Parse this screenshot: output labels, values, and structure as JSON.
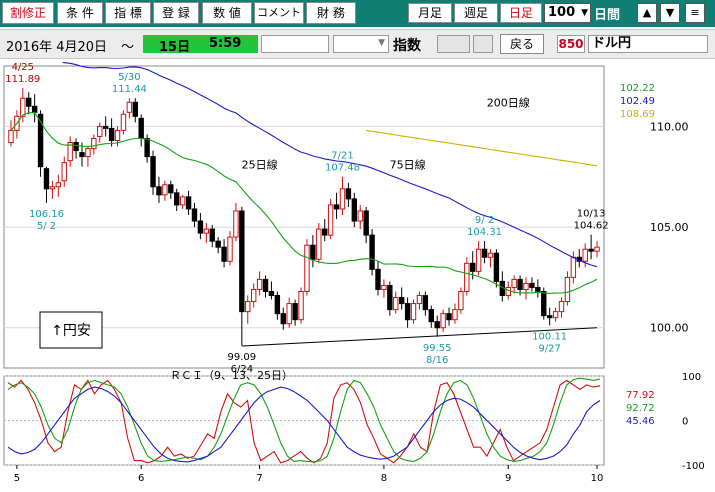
{
  "toolbar": {
    "buttons": [
      "割修正",
      "条 件",
      "指 標",
      "登 録",
      "数 値",
      "コメント",
      "財 務"
    ],
    "periods": [
      "月足",
      "週足",
      "日足"
    ],
    "count_value": "100",
    "days_label": "日間",
    "nav_up": "▲",
    "nav_down": "▼",
    "menu": "≡",
    "colors": {
      "bg": "#0f7f74",
      "active": "#d0021b"
    }
  },
  "infobar": {
    "date": "2016年 4月20日",
    "tilde": "〜",
    "day": "15日",
    "time": "5:59",
    "index_label": "指数",
    "back_label": "戻る",
    "code": "850",
    "name": "ドル円"
  },
  "chart_data": [
    {
      "type": "candlestick",
      "ylim": [
        98,
        113
      ],
      "y_ticks": [
        "110.00",
        "105.00",
        "100.00"
      ],
      "x_ticks": [
        "5",
        "6",
        "7",
        "8",
        "9",
        "10"
      ],
      "legend": [
        {
          "value": "102.22",
          "color": "#16a016"
        },
        {
          "value": "102.49",
          "color": "#1a1ad0"
        },
        {
          "value": "108.69",
          "color": "#c8b400"
        }
      ],
      "ma_labels": {
        "ma25": "25日線",
        "ma75": "75日線",
        "ma200": "200日線"
      },
      "annotations": [
        {
          "date": "4/25",
          "value": "111.89"
        },
        {
          "date": "5/ 2",
          "value": "106.16"
        },
        {
          "date": "5/30",
          "value": "111.44"
        },
        {
          "date": "6/24",
          "value": "99.09"
        },
        {
          "date": "7/21",
          "value": "107.48"
        },
        {
          "date": "8/16",
          "value": "99.55"
        },
        {
          "date": "9/ 2",
          "value": "104.31"
        },
        {
          "date": "9/27",
          "value": "100.11"
        },
        {
          "date": "10/13",
          "value": "104.62"
        }
      ],
      "note": "↑円安",
      "candles": [
        [
          109.2,
          110.3,
          109.0,
          109.8
        ],
        [
          109.8,
          110.8,
          109.4,
          110.5
        ],
        [
          110.5,
          111.9,
          110.2,
          111.4
        ],
        [
          111.4,
          111.7,
          110.6,
          111.0
        ],
        [
          111.0,
          111.6,
          110.2,
          110.7
        ],
        [
          110.6,
          110.8,
          107.5,
          108.0
        ],
        [
          107.9,
          108.0,
          106.2,
          106.9
        ],
        [
          106.9,
          107.3,
          106.4,
          107.0
        ],
        [
          107.0,
          107.6,
          106.5,
          107.2
        ],
        [
          107.3,
          108.5,
          107.0,
          108.2
        ],
        [
          108.3,
          109.5,
          108.0,
          109.2
        ],
        [
          109.2,
          109.4,
          108.4,
          108.8
        ],
        [
          108.7,
          109.2,
          108.0,
          108.5
        ],
        [
          108.5,
          109.0,
          108.0,
          108.9
        ],
        [
          108.9,
          109.6,
          108.6,
          109.4
        ],
        [
          109.5,
          110.2,
          109.2,
          110.0
        ],
        [
          110.0,
          110.5,
          109.5,
          109.9
        ],
        [
          109.9,
          110.4,
          109.0,
          109.3
        ],
        [
          109.3,
          110.0,
          109.0,
          109.8
        ],
        [
          109.8,
          110.8,
          109.6,
          110.6
        ],
        [
          110.7,
          111.4,
          110.4,
          111.2
        ],
        [
          111.2,
          111.4,
          110.2,
          110.5
        ],
        [
          110.4,
          110.6,
          109.0,
          109.4
        ],
        [
          109.4,
          109.6,
          108.2,
          108.5
        ],
        [
          108.5,
          108.8,
          106.6,
          107.0
        ],
        [
          107.0,
          107.5,
          106.2,
          106.6
        ],
        [
          106.6,
          107.3,
          106.3,
          107.1
        ],
        [
          107.1,
          107.3,
          106.4,
          106.7
        ],
        [
          106.7,
          106.9,
          105.8,
          106.1
        ],
        [
          106.1,
          106.6,
          105.9,
          106.5
        ],
        [
          106.5,
          106.8,
          105.6,
          105.9
        ],
        [
          105.9,
          106.2,
          105.0,
          105.3
        ],
        [
          105.3,
          105.7,
          104.4,
          104.7
        ],
        [
          104.7,
          105.2,
          104.2,
          104.9
        ],
        [
          104.9,
          105.1,
          104.0,
          104.3
        ],
        [
          104.3,
          104.5,
          103.7,
          104.0
        ],
        [
          104.0,
          104.4,
          103.0,
          103.3
        ],
        [
          103.3,
          104.8,
          103.1,
          104.5
        ],
        [
          104.5,
          106.2,
          104.3,
          105.8
        ],
        [
          105.8,
          106.0,
          99.1,
          100.8
        ],
        [
          100.8,
          101.6,
          100.2,
          101.3
        ],
        [
          101.3,
          102.2,
          101.0,
          101.9
        ],
        [
          101.9,
          102.8,
          101.6,
          102.4
        ],
        [
          102.4,
          102.6,
          101.5,
          101.8
        ],
        [
          101.8,
          102.3,
          101.4,
          101.6
        ],
        [
          101.6,
          101.8,
          100.4,
          100.7
        ],
        [
          100.7,
          101.0,
          99.9,
          100.2
        ],
        [
          100.2,
          101.5,
          100.0,
          101.2
        ],
        [
          101.2,
          101.4,
          100.1,
          100.4
        ],
        [
          100.4,
          102.0,
          100.2,
          101.8
        ],
        [
          101.8,
          104.4,
          101.6,
          104.1
        ],
        [
          104.1,
          104.6,
          103.0,
          103.4
        ],
        [
          103.4,
          105.2,
          103.2,
          104.9
        ],
        [
          104.9,
          105.4,
          104.3,
          104.6
        ],
        [
          104.6,
          106.4,
          104.4,
          106.1
        ],
        [
          106.1,
          106.7,
          105.4,
          105.9
        ],
        [
          105.9,
          107.5,
          105.6,
          106.9
        ],
        [
          106.9,
          107.2,
          106.0,
          106.4
        ],
        [
          106.4,
          106.7,
          105.0,
          105.3
        ],
        [
          105.3,
          106.1,
          104.9,
          105.8
        ],
        [
          105.8,
          106.0,
          104.2,
          104.6
        ],
        [
          104.6,
          104.9,
          102.6,
          102.9
        ],
        [
          102.9,
          103.3,
          101.6,
          101.9
        ],
        [
          101.9,
          102.4,
          101.5,
          102.1
        ],
        [
          102.1,
          102.3,
          100.6,
          100.9
        ],
        [
          100.9,
          101.8,
          100.7,
          101.5
        ],
        [
          101.5,
          102.0,
          100.9,
          101.2
        ],
        [
          101.2,
          101.5,
          100.0,
          100.4
        ],
        [
          100.4,
          101.4,
          100.2,
          101.2
        ],
        [
          101.2,
          101.8,
          100.9,
          101.6
        ],
        [
          101.6,
          101.8,
          100.6,
          100.9
        ],
        [
          100.9,
          101.1,
          100.0,
          100.3
        ],
        [
          100.3,
          100.6,
          99.55,
          100.0
        ],
        [
          100.0,
          100.9,
          99.8,
          100.7
        ],
        [
          100.7,
          101.0,
          100.1,
          100.4
        ],
        [
          100.4,
          101.2,
          100.2,
          100.9
        ],
        [
          100.9,
          102.0,
          100.7,
          101.8
        ],
        [
          101.8,
          103.5,
          101.6,
          103.2
        ],
        [
          103.2,
          103.8,
          102.4,
          102.8
        ],
        [
          102.8,
          104.3,
          102.6,
          103.9
        ],
        [
          103.9,
          104.31,
          103.2,
          103.5
        ],
        [
          103.5,
          103.9,
          103.0,
          103.7
        ],
        [
          103.7,
          103.9,
          102.0,
          102.3
        ],
        [
          102.3,
          102.8,
          101.3,
          101.6
        ],
        [
          101.6,
          102.3,
          101.4,
          102.0
        ],
        [
          102.0,
          102.6,
          101.7,
          102.4
        ],
        [
          102.4,
          102.6,
          101.6,
          101.9
        ],
        [
          101.9,
          102.5,
          101.4,
          102.2
        ],
        [
          102.2,
          102.5,
          101.8,
          102.0
        ],
        [
          102.0,
          102.4,
          101.5,
          101.8
        ],
        [
          101.8,
          102.0,
          100.4,
          100.6
        ],
        [
          100.6,
          101.0,
          100.11,
          100.5
        ],
        [
          100.5,
          101.0,
          100.3,
          100.8
        ],
        [
          100.8,
          101.5,
          100.5,
          101.3
        ],
        [
          101.3,
          102.8,
          101.1,
          102.5
        ],
        [
          102.5,
          103.8,
          102.2,
          103.5
        ],
        [
          103.5,
          103.9,
          103.0,
          103.3
        ],
        [
          103.3,
          104.2,
          103.0,
          103.9
        ],
        [
          103.9,
          104.62,
          103.4,
          103.8
        ],
        [
          103.8,
          104.3,
          103.5,
          104.0
        ]
      ]
    },
    {
      "type": "line",
      "title": "ＲＣＩ（9、13、25日）",
      "ylim": [
        -100,
        100
      ],
      "y_ticks": [
        "100",
        "0",
        "-100"
      ],
      "legend": [
        {
          "value": "77.92",
          "color": "#d01010"
        },
        {
          "value": "92.72",
          "color": "#16a016"
        },
        {
          "value": "45.46",
          "color": "#1a1ad0"
        }
      ],
      "series": [
        {
          "color": "#d01010",
          "values": [
            85,
            75,
            90,
            70,
            40,
            0,
            -50,
            -70,
            -60,
            20,
            80,
            70,
            90,
            60,
            80,
            90,
            70,
            40,
            -40,
            -90,
            -90,
            -95,
            -90,
            -80,
            -60,
            -80,
            -75,
            -85,
            -80,
            -55,
            -30,
            -40,
            20,
            60,
            40,
            30,
            45,
            -50,
            -90,
            -80,
            -70,
            -95,
            -90,
            -80,
            -70,
            -85,
            -95,
            -85,
            -50,
            50,
            80,
            85,
            70,
            40,
            -10,
            -40,
            -75,
            -85,
            -95,
            -80,
            -60,
            -30,
            -60,
            -70,
            20,
            80,
            85,
            60,
            20,
            -20,
            -60,
            -60,
            -80,
            -50,
            -20,
            -60,
            -90,
            -80,
            -70,
            -60,
            -50,
            -20,
            30,
            80,
            90,
            80,
            70,
            80,
            75,
            78
          ]
        },
        {
          "color": "#16a016",
          "values": [
            70,
            80,
            85,
            75,
            60,
            30,
            -10,
            -40,
            -50,
            -20,
            30,
            70,
            85,
            90,
            85,
            80,
            75,
            60,
            30,
            -10,
            -50,
            -80,
            -90,
            -92,
            -90,
            -88,
            -85,
            -82,
            -85,
            -88,
            -80,
            -60,
            -30,
            10,
            50,
            80,
            85,
            80,
            60,
            30,
            -10,
            -50,
            -80,
            -92,
            -90,
            -92,
            -93,
            -90,
            -80,
            -40,
            20,
            70,
            90,
            85,
            60,
            30,
            -10,
            -40,
            -70,
            -85,
            -90,
            -92,
            -85,
            -70,
            -30,
            20,
            60,
            85,
            90,
            80,
            50,
            10,
            -30,
            -60,
            -80,
            -88,
            -92,
            -90,
            -85,
            -80,
            -70,
            -50,
            -10,
            40,
            80,
            92,
            95,
            93,
            90,
            93
          ]
        },
        {
          "color": "#1a1ad0",
          "values": [
            -60,
            -70,
            -75,
            -72,
            -65,
            -50,
            -30,
            -10,
            10,
            30,
            50,
            60,
            70,
            75,
            72,
            65,
            55,
            40,
            20,
            0,
            -20,
            -40,
            -60,
            -75,
            -85,
            -90,
            -92,
            -93,
            -90,
            -85,
            -80,
            -70,
            -60,
            -40,
            -20,
            0,
            20,
            40,
            55,
            65,
            70,
            75,
            72,
            65,
            55,
            45,
            30,
            15,
            0,
            -20,
            -40,
            -60,
            -70,
            -78,
            -82,
            -85,
            -87,
            -85,
            -80,
            -70,
            -60,
            -40,
            -20,
            0,
            20,
            35,
            45,
            50,
            48,
            40,
            30,
            15,
            0,
            -15,
            -30,
            -45,
            -60,
            -72,
            -80,
            -85,
            -88,
            -85,
            -80,
            -70,
            -55,
            -30,
            -10,
            20,
            35,
            45
          ]
        }
      ]
    }
  ]
}
